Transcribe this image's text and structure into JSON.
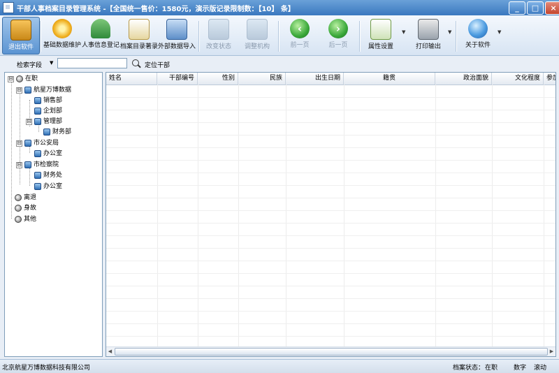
{
  "window": {
    "title": "干部人事档案目录管理系统 -【全国统一售价：1580元，演示版记录限制数：【10】 条】",
    "controls": [
      "_",
      "□",
      "×"
    ]
  },
  "toolbar": {
    "items": [
      {
        "label": "退出软件",
        "icon": "exit-icon",
        "state": "active"
      },
      {
        "label": "基础数据维护",
        "icon": "gear-icon"
      },
      {
        "label": "人事信息登记",
        "icon": "people-icon"
      },
      {
        "label": "档案目录著录",
        "icon": "documents-icon"
      },
      {
        "label": "外部数据导入",
        "icon": "import-icon"
      },
      {
        "label": "改变状态",
        "icon": "change-state-icon",
        "state": "disabled"
      },
      {
        "label": "调整机构",
        "icon": "adjust-org-icon",
        "state": "disabled"
      },
      {
        "label": "前一页",
        "icon": "prev-page-icon",
        "state": "disabled"
      },
      {
        "label": "后一页",
        "icon": "next-page-icon",
        "state": "disabled"
      },
      {
        "label": "属性设置",
        "icon": "properties-icon"
      },
      {
        "label": "打印输出",
        "icon": "print-icon"
      },
      {
        "label": "关于软件",
        "icon": "about-icon"
      }
    ]
  },
  "search": {
    "field_label": "检索字段",
    "value": "",
    "locate_label": "定位干部"
  },
  "tree": {
    "nodes": [
      {
        "label": "在职",
        "expander": "⊟"
      },
      {
        "label": "航星万博数据",
        "expander": "⊟"
      },
      {
        "label": "销售部"
      },
      {
        "label": "企划部"
      },
      {
        "label": "管理部",
        "expander": "⊟"
      },
      {
        "label": "财务部"
      },
      {
        "label": "市公安局",
        "expander": "⊟"
      },
      {
        "label": "办公室"
      },
      {
        "label": "市检察院",
        "expander": "⊟"
      },
      {
        "label": "财务处"
      },
      {
        "label": "办公室"
      },
      {
        "label": "离退"
      },
      {
        "label": "身故"
      },
      {
        "label": "其他"
      }
    ]
  },
  "grid": {
    "columns": [
      "姓名",
      "干部编号",
      "性别",
      "民族",
      "出生日期",
      "籍贯",
      "政治面貌",
      "文化程度",
      "参加"
    ],
    "rows": []
  },
  "statusbar": {
    "company": "北京航星万博数据科技有限公司",
    "archive_state_label": "档案状态：",
    "archive_state_value": "在职",
    "num_lock": "数字",
    "scroll_lock": "滚动"
  }
}
